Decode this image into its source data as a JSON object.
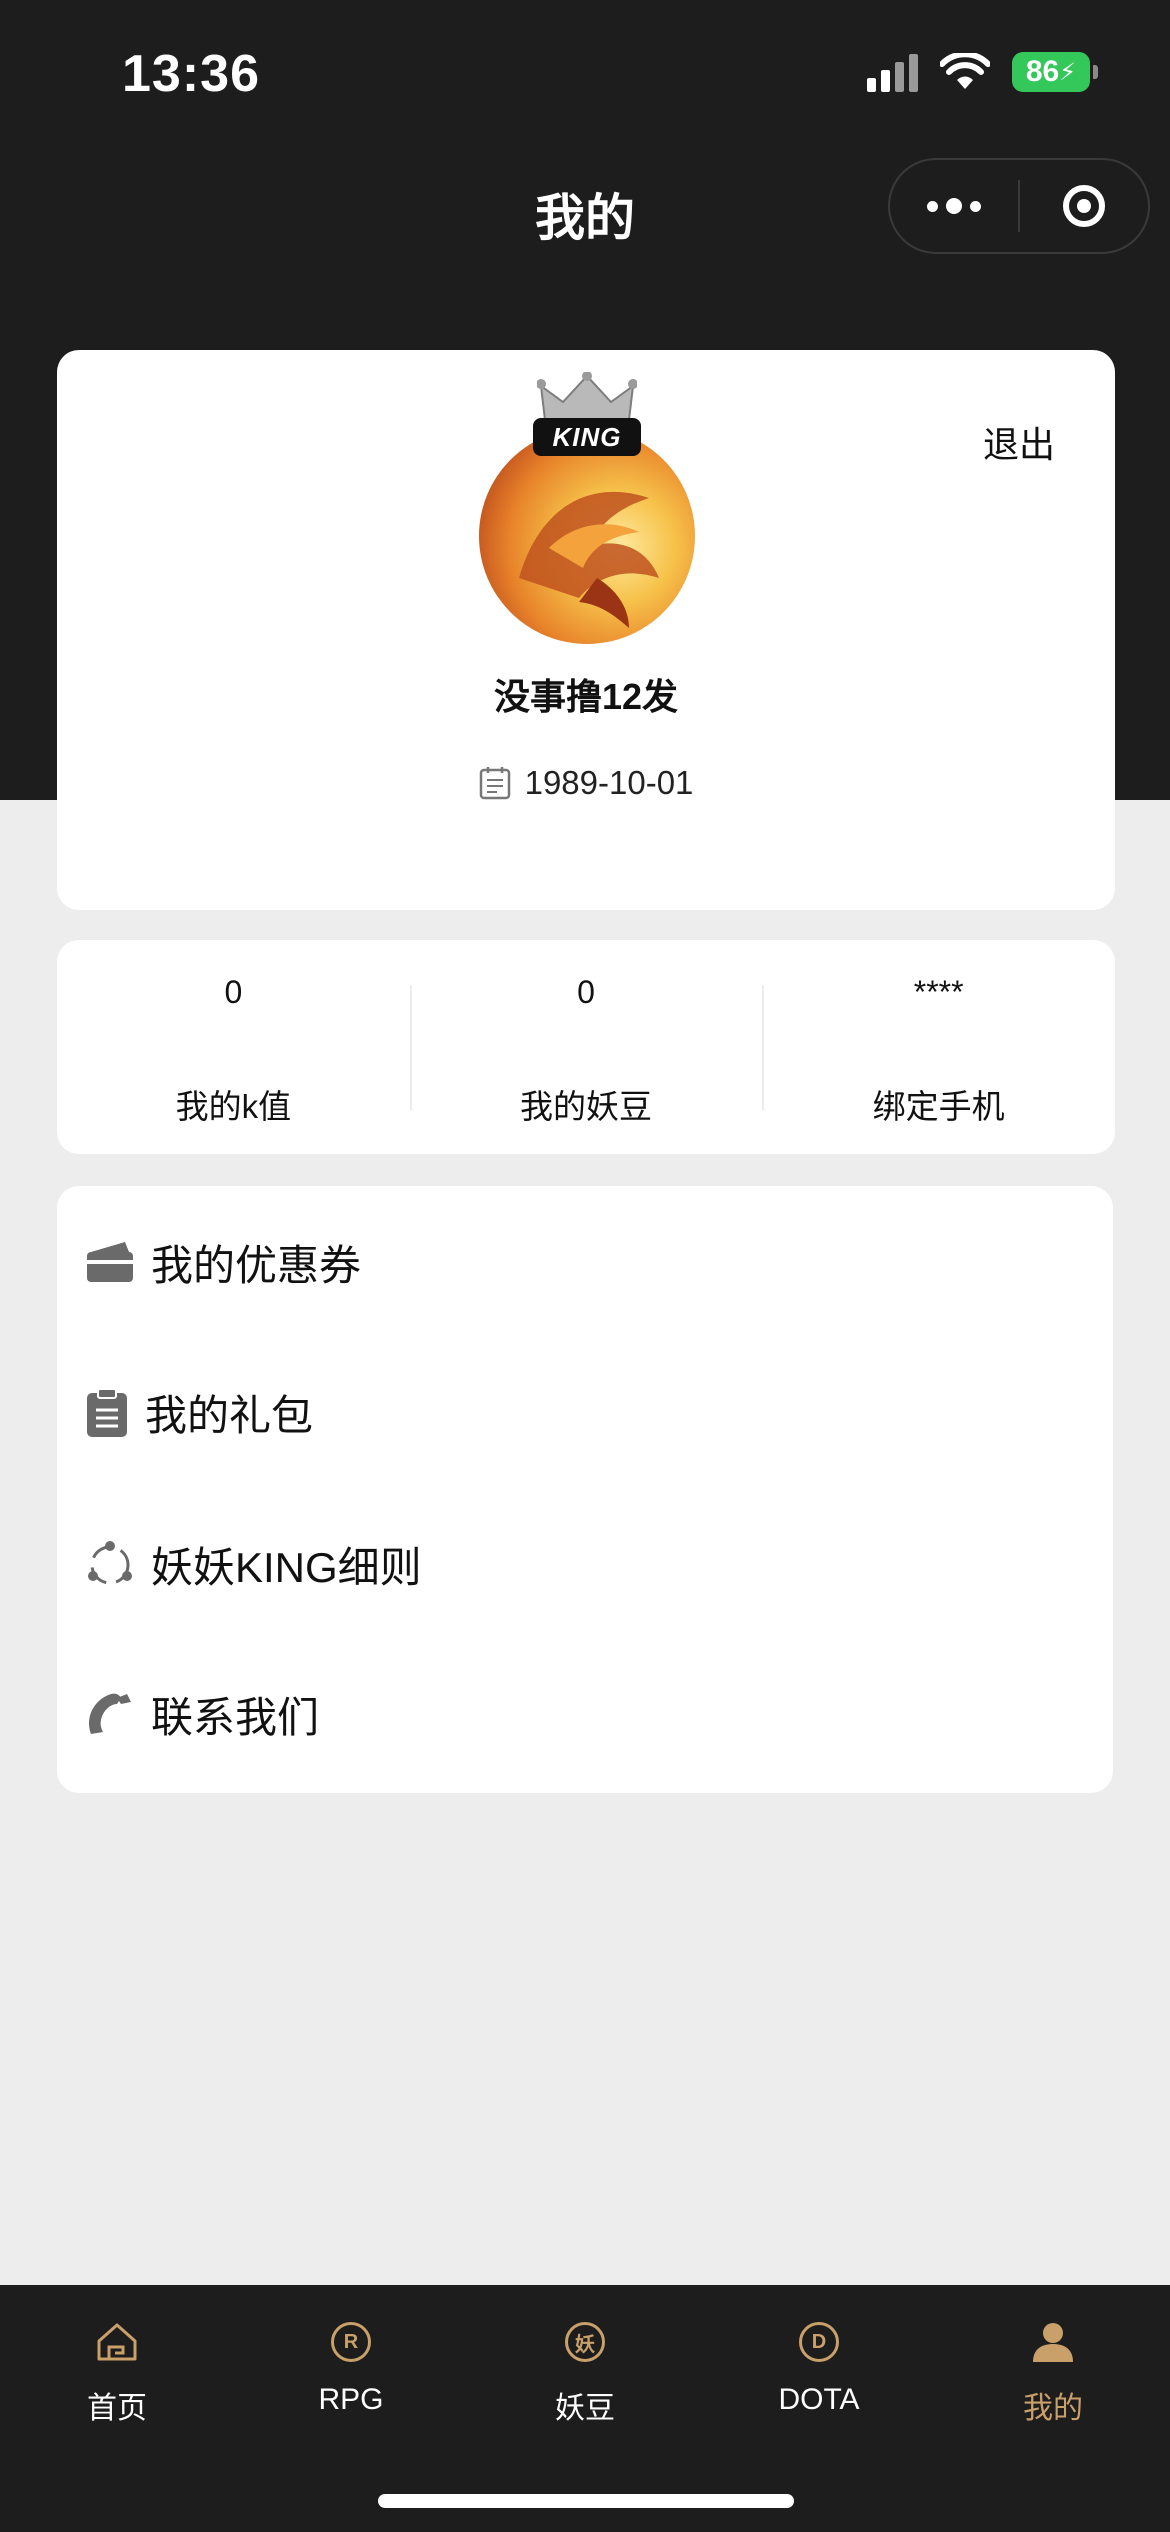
{
  "status_bar": {
    "time": "13:36",
    "battery": "86"
  },
  "nav": {
    "title": "我的"
  },
  "profile": {
    "logout_label": "退出",
    "badge": "KING",
    "username": "没事撸12发",
    "birthday": "1989-10-01"
  },
  "stats": [
    {
      "value": "0",
      "label": "我的k值"
    },
    {
      "value": "0",
      "label": "我的妖豆"
    },
    {
      "value": "****",
      "label": "绑定手机"
    }
  ],
  "menu": [
    {
      "label": "我的优惠券",
      "icon": "wallet-icon"
    },
    {
      "label": "我的礼包",
      "icon": "clipboard-icon"
    },
    {
      "label": "妖妖KING细则",
      "icon": "share-icon"
    },
    {
      "label": "联系我们",
      "icon": "phone-icon"
    }
  ],
  "tabbar": [
    {
      "label": "首页",
      "icon": "home-icon"
    },
    {
      "label": "RPG",
      "icon": "rpg-icon",
      "glyph": "R"
    },
    {
      "label": "妖豆",
      "icon": "yaodou-icon",
      "glyph": "妖"
    },
    {
      "label": "DOTA",
      "icon": "dota-icon",
      "glyph": "D"
    },
    {
      "label": "我的",
      "icon": "user-icon",
      "active": true
    }
  ],
  "colors": {
    "header_bg": "#1d1d1d",
    "page_bg": "#ededed",
    "accent_gold": "#c9a06a",
    "battery_green": "#34c759"
  }
}
